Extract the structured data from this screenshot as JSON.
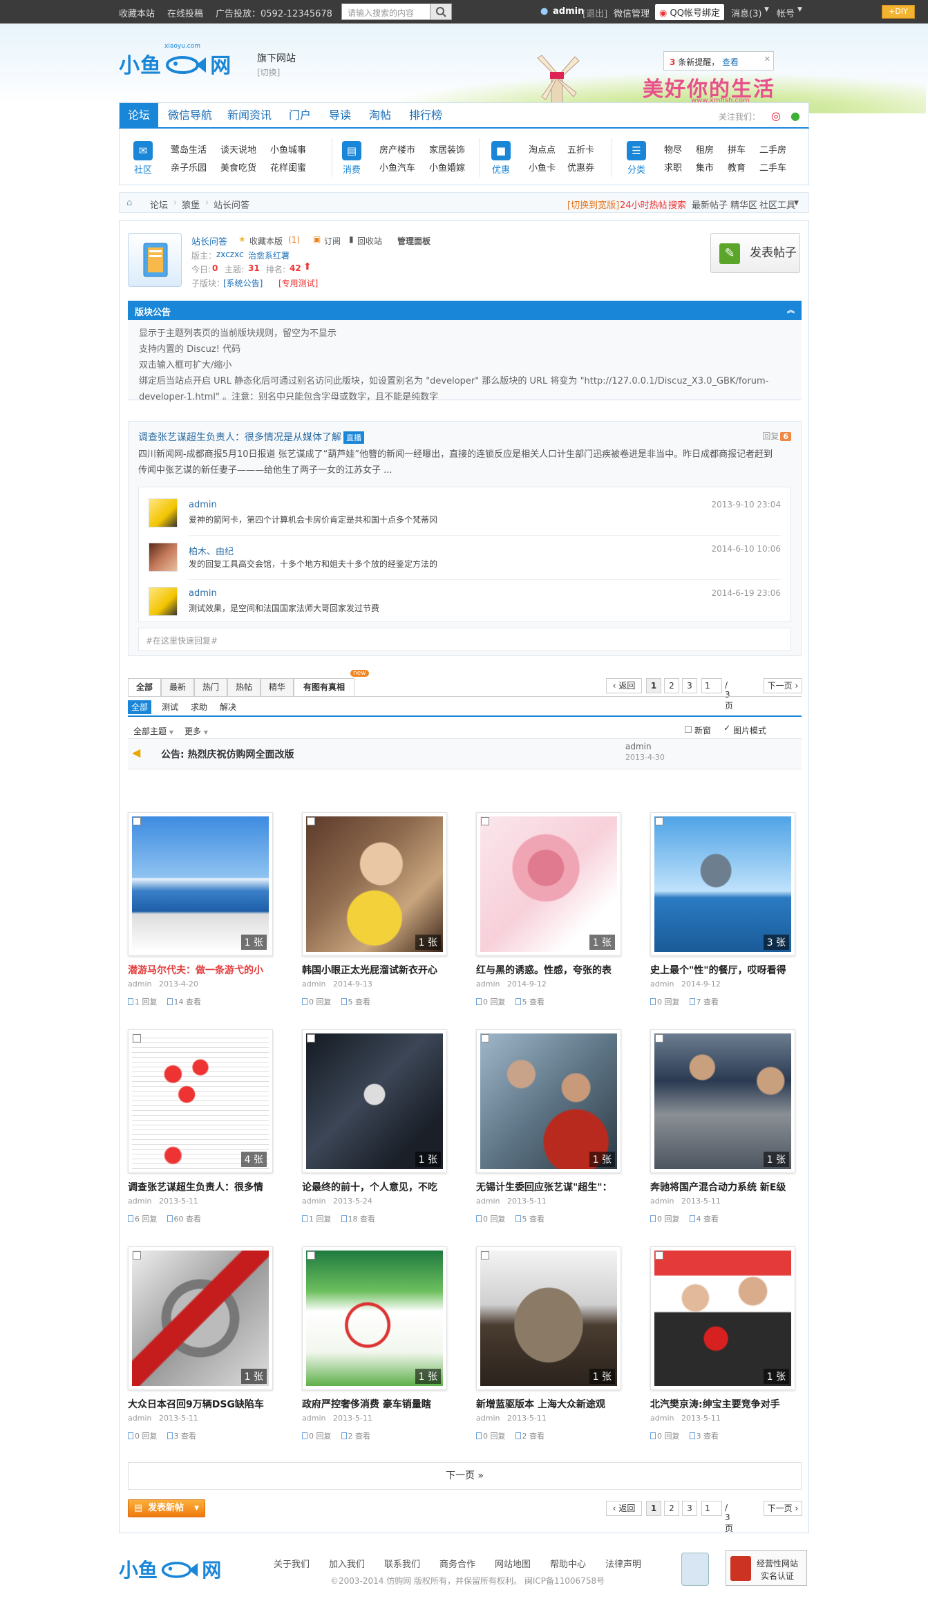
{
  "topbar": {
    "favorite": "收藏本站",
    "contribute": "在线投稿",
    "ad": "广告投放：0592-12345678",
    "search_placeholder": "请输入搜索的内容",
    "user": "admin",
    "logout": "[退出]",
    "wechat": "微信管理",
    "qq": "QQ帐号绑定",
    "messages": "消息(3)",
    "account": "帐号",
    "diy": "DIY"
  },
  "header": {
    "logo_text": "小鱼",
    "logo_text2": "网",
    "logo_url": "xiaoyu.com",
    "flagsite": "旗下网站",
    "switch": "[切换]",
    "slogan": "美好你的生活",
    "slogan_url": "www.xmfish.com",
    "notice_count": "3",
    "notice_text": "条新提醒，",
    "notice_link": "查看"
  },
  "nav": {
    "items": [
      "论坛",
      "微信导航",
      "新闻资讯",
      "门户",
      "导读",
      "淘帖",
      "排行榜"
    ],
    "follow": "关注我们："
  },
  "subnav": [
    {
      "icon": "社区",
      "links": [
        "鹭岛生活",
        "谈天说地",
        "小鱼城事",
        "亲子乐园",
        "美食吃货",
        "花样闺蜜"
      ]
    },
    {
      "icon": "消费",
      "links": [
        "房产楼市",
        "家居装饰",
        "小鱼汽车",
        "小鱼婚嫁"
      ]
    },
    {
      "icon": "优惠",
      "links": [
        "淘点点",
        "五折卡",
        "小鱼卡",
        "优惠券"
      ]
    },
    {
      "icon": "分类",
      "links": [
        "物尽",
        "租房",
        "拼车",
        "二手房",
        "求职",
        "集市",
        "教育",
        "二手车"
      ]
    }
  ],
  "crumb": {
    "items": [
      "论坛",
      "狼堡",
      "站长问答"
    ],
    "right": [
      "[切换到宽版]",
      "24小时热帖",
      "搜索",
      "最新帖子",
      "精华区",
      "社区工具"
    ]
  },
  "forum": {
    "name": "站长问答",
    "fav": "收藏本版",
    "fav_count": "(1)",
    "rss": "订阅",
    "recycle": "回收站",
    "panel": "管理面板",
    "mods_label": "版主：",
    "mods": "zxczxc",
    "mods2": "治愈系红薯",
    "today_label": "今日:",
    "today": "0",
    "topics_label": "主题:",
    "topics": "31",
    "rank_label": "排名:",
    "rank": "42",
    "sub_label": "子版块：",
    "sub1": "[系统公告]",
    "sub2": "[专用测试]",
    "post_btn": "发表帖子"
  },
  "announcement": {
    "title": "版块公告",
    "lines": [
      "显示于主题列表页的当前版块规则，留空为不显示",
      "支持内置的 Discuz! 代码",
      "双击输入框可扩大/缩小",
      "绑定后当站点开启 URL 静态化后可通过别名访问此版块，如设置别名为 \"developer\" 那么版块的 URL 将变为 \"http://127.0.0.1/Discuz_X3.0_GBK/forum-developer-1.html\" 。注意：别名中只能包含字母或数字，且不能是纯数字"
    ]
  },
  "hot": {
    "title": "调查张艺谋超生负责人：很多情况是从媒体了解",
    "tag": "直播",
    "reply_label": "回复",
    "reply_count": "6",
    "desc": "四川新闻网-成都商报5月10日报道 张艺谋成了“葫芦娃”他簪的新闻一经曝出，直接的连锁反应是相关人口计生部门迅疾被卷进是非当中。昨日成都商报记者赶到传闻中张艺谋的新任妻子———给他生了两子一女的江苏女子 ...",
    "replies": [
      {
        "name": "admin",
        "text": "爱神的箭阿卡，第四个计算机会卡房价肯定是共和国十点多个梵蒂冈",
        "date": "2013-9-10 23:04"
      },
      {
        "name": "柏木、由纪",
        "text": "发的回复工具高交会馆，十多个地方和姐夫十多个放的经鉴定方法的",
        "date": "2014-6-10 10:06"
      },
      {
        "name": "admin",
        "text": "测试效果，是空间和法国国家法师大哥回家发过节费",
        "date": "2014-6-19 23:06"
      }
    ],
    "quick": "#在这里快速回复#"
  },
  "tabs": [
    "全部",
    "最新",
    "热门",
    "热帖",
    "精华",
    "有图有真相"
  ],
  "new_badge": "new",
  "pager": {
    "back": "返回",
    "pages": [
      "1",
      "2",
      "3"
    ],
    "input": "1",
    "total": "/ 3 页",
    "next": "下一页"
  },
  "subtabs": [
    "全部",
    "测试",
    "求助",
    "解决"
  ],
  "filter": {
    "all": "全部主题",
    "more": "更多",
    "newwin": "新窗",
    "picmode": "图片模式"
  },
  "sticky": {
    "title": "公告: 热烈庆祝仿购网全面改版",
    "author": "admin",
    "date": "2013-4-30"
  },
  "cards": [
    {
      "title": "潜游马尔代夫：做一条游弋的小",
      "red": true,
      "author": "admin",
      "date": "2013-4-20",
      "replies": "1 回复",
      "views": "14 查看",
      "count": "1 张"
    },
    {
      "title": "韩国小眼正太光屁溜试新衣开心",
      "author": "admin",
      "date": "2014-9-13",
      "replies": "0 回复",
      "views": "5 查看",
      "count": "1 张"
    },
    {
      "title": "红与黑的诱惑。性感，夸张的表",
      "author": "admin",
      "date": "2014-9-12",
      "replies": "0 回复",
      "views": "5 查看",
      "count": "1 张"
    },
    {
      "title": "史上最个\"性\"的餐厅，哎呀看得",
      "author": "admin",
      "date": "2014-9-12",
      "replies": "0 回复",
      "views": "7 查看",
      "count": "3 张"
    },
    {
      "title": "调查张艺谋超生负责人：很多情",
      "author": "admin",
      "date": "2013-5-11",
      "replies": "6 回复",
      "views": "60 查看",
      "count": "4 张"
    },
    {
      "title": "论最终的前十，个人意见，不吃",
      "author": "admin",
      "date": "2013-5-24",
      "replies": "1 回复",
      "views": "18 查看",
      "count": "1 张"
    },
    {
      "title": "无锡计生委回应张艺谋\"超生\"：",
      "author": "admin",
      "date": "2013-5-11",
      "replies": "0 回复",
      "views": "5 查看",
      "count": "1 张"
    },
    {
      "title": "奔驰将国产混合动力系统 新E级",
      "author": "admin",
      "date": "2013-5-11",
      "replies": "0 回复",
      "views": "4 查看",
      "count": "1 张"
    },
    {
      "title": "大众日本召回9万辆DSG缺陷车",
      "author": "admin",
      "date": "2013-5-11",
      "replies": "0 回复",
      "views": "3 查看",
      "count": "1 张"
    },
    {
      "title": "政府严控奢侈消费 豪车销量瞎",
      "author": "admin",
      "date": "2013-5-11",
      "replies": "0 回复",
      "views": "2 查看",
      "count": "1 张"
    },
    {
      "title": "新增蓝驱版本 上海大众新途观",
      "author": "admin",
      "date": "2013-5-11",
      "replies": "0 回复",
      "views": "2 查看",
      "count": "1 张"
    },
    {
      "title": "北汽樊京涛:绅宝主要竞争对手",
      "author": "admin",
      "date": "2013-5-11",
      "replies": "0 回复",
      "views": "3 查看",
      "count": "1 张"
    }
  ],
  "nextpage": "下一页 »",
  "newpost": "发表新帖",
  "footer": {
    "links": [
      "关于我们",
      "加入我们",
      "联系我们",
      "商务合作",
      "网站地图",
      "帮助中心",
      "法律声明"
    ],
    "copy": "©2003-2014 仿购网 版权所有，并保留所有权利。 闽ICP备11006758号",
    "badge_line1": "经营性网站",
    "badge_line2": "实名认证"
  },
  "colors": {
    "accent": "#1a86d8",
    "topbar": "#3b3b3b",
    "orange": "#f07a0d"
  }
}
